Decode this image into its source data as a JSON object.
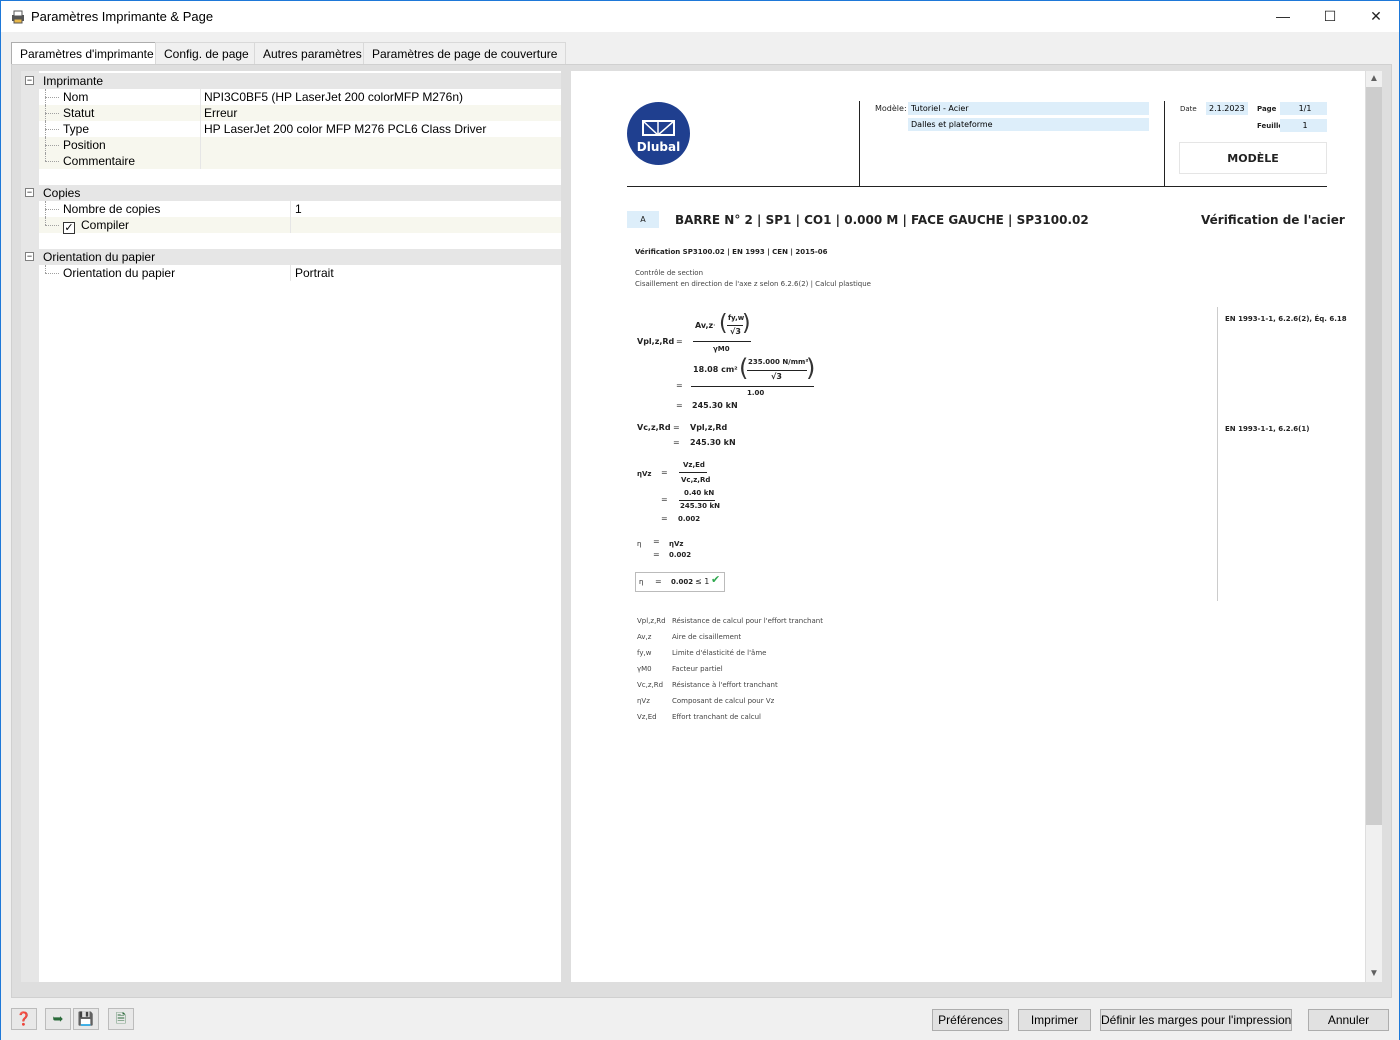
{
  "window": {
    "title": "Paramètres Imprimante & Page"
  },
  "tabs": [
    {
      "label": "Paramètres d'imprimante"
    },
    {
      "label": "Config. de page"
    },
    {
      "label": "Autres paramètres"
    },
    {
      "label": "Paramètres de page de couverture"
    }
  ],
  "properties": {
    "printer": {
      "label": "Imprimante",
      "rows": [
        {
          "name": "Nom",
          "value": "NPI3C0BF5 (HP LaserJet 200 colorMFP M276n)"
        },
        {
          "name": "Statut",
          "value": "Erreur"
        },
        {
          "name": "Type",
          "value": "HP LaserJet 200 color MFP M276 PCL6 Class Driver"
        },
        {
          "name": "Position",
          "value": ""
        },
        {
          "name": "Commentaire",
          "value": ""
        }
      ]
    },
    "copies": {
      "label": "Copies",
      "count_label": "Nombre de copies",
      "count_value": "1",
      "collate_label": "Compiler",
      "collate_checked": true
    },
    "orientation": {
      "label": "Orientation du papier",
      "row_label": "Orientation du papier",
      "row_value": "Portrait"
    }
  },
  "preview": {
    "logo_text": "Dlubal",
    "model_label": "Modèle:",
    "model_value": "Tutoriel - Acier",
    "model_sub": "Dalles et plateforme",
    "date_label": "Date",
    "date_value": "2.1.2023",
    "page_label": "Page",
    "page_value": "1/1",
    "sheet_label": "Feuille",
    "sheet_value": "1",
    "stamp": "MODÈLE",
    "section_marker": "A",
    "heading": "BARRE N° 2 | SP1 | CO1 | 0.000 M | FACE GAUCHE | SP3100.02",
    "heading_right": "Vérification de l'acier",
    "subheading": "Vérification SP3100.02 | EN 1993 | CEN | 2015-06",
    "desc1": "Contrôle de section",
    "desc2": "Cisaillement en direction de l'axe z selon 6.2.6(2) | Calcul plastique",
    "ref1": "EN 1993-1-1, 6.2.6(2), Éq. 6.18",
    "ref2": "EN 1993-1-1, 6.2.6(1)",
    "eq": {
      "vpl": "Vpl,z,Rd",
      "av": "Av,z",
      "fyw": "fy,w",
      "sqrt3": "√3",
      "gm0": "γM0",
      "n_av": "18.08 cm²",
      "n_fy": "235.000 N/mm²",
      "n_gm": "1.00",
      "r1": "245.30 kN",
      "vc": "Vc,z,Rd",
      "vpl2": "Vpl,z,Rd",
      "r2": "245.30 kN",
      "eta": "ηVz",
      "ved": "Vz,Ed",
      "vcd": "Vc,z,Rd",
      "n_ved": "0.40 kN",
      "n_vcd": "245.30 kN",
      "r3": "0.002",
      "eta0": "η",
      "etavz": "ηVz",
      "r4": "0.002",
      "final": "0.002",
      "limit": "≤ 1",
      "eq_sign": "=",
      "dot": "·"
    },
    "legend": [
      {
        "sym": "Vpl,z,Rd",
        "text": "Résistance de calcul pour l'effort tranchant"
      },
      {
        "sym": "Av,z",
        "text": "Aire de cisaillement"
      },
      {
        "sym": "fy,w",
        "text": "Limite d'élasticité de l'âme"
      },
      {
        "sym": "γM0",
        "text": "Facteur partiel"
      },
      {
        "sym": "Vc,z,Rd",
        "text": "Résistance à l'effort tranchant"
      },
      {
        "sym": "ηVz",
        "text": "Composant de calcul pour Vz"
      },
      {
        "sym": "Vz,Ed",
        "text": "Effort tranchant de calcul"
      }
    ]
  },
  "buttons": {
    "preferences": "Préférences",
    "print": "Imprimer",
    "margins": "Définir les marges pour l'impression",
    "cancel": "Annuler"
  },
  "icons": {
    "help": "help-icon",
    "app": "printer-app-icon"
  },
  "colors": {
    "logo": "#1f3f8f",
    "header_field": "#ddeefa",
    "check": "#2fa84f"
  }
}
